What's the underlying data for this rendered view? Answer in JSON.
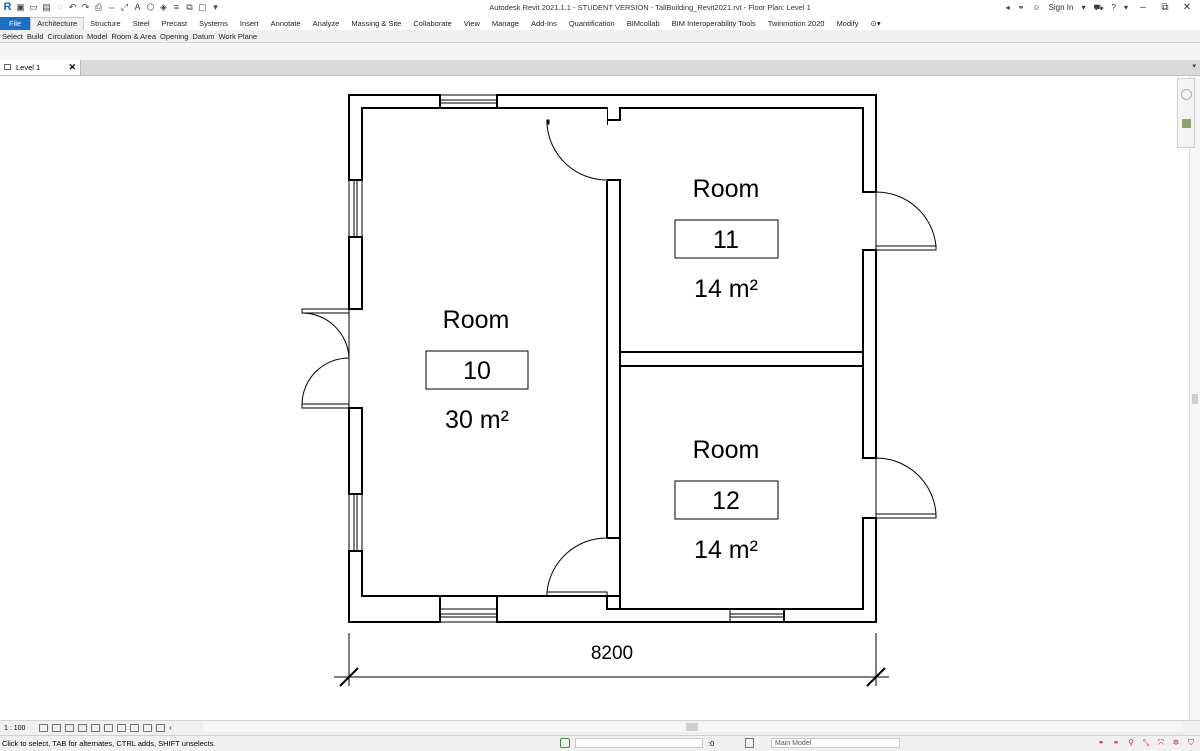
{
  "app": {
    "title": "Autodesk Revit 2021.1.1 - STUDENT VERSION - TallBuilding_Revit2021.rvt - Floor Plan: Level 1",
    "sign_in": "Sign In",
    "help": "?"
  },
  "quick_access": {
    "logo": "R",
    "text_tool": "A"
  },
  "ribbon": {
    "tabs": [
      "File",
      "Architecture",
      "Structure",
      "Steel",
      "Precast",
      "Systems",
      "Insert",
      "Annotate",
      "Analyze",
      "Massing & Site",
      "Collaborate",
      "View",
      "Manage",
      "Add-Ins",
      "Quantification",
      "BIMcollab",
      "BIM Interoperability Tools",
      "Twinmotion 2020",
      "Modify"
    ],
    "active_tab": "Architecture",
    "panels": [
      "Select",
      "Build",
      "Circulation",
      "Model",
      "Room & Area",
      "Opening",
      "Datum",
      "Work Plane"
    ]
  },
  "view_tab": {
    "label": "Level 1",
    "close": "✕"
  },
  "plan": {
    "rooms": [
      {
        "name": "Room",
        "number": "10",
        "area": "30 m²"
      },
      {
        "name": "Room",
        "number": "11",
        "area": "14 m²"
      },
      {
        "name": "Room",
        "number": "12",
        "area": "14 m²"
      }
    ],
    "dimension": "8200"
  },
  "view_control": {
    "scale": "1 : 100"
  },
  "status": {
    "message": "Click to select, TAB for alternates, CTRL adds, SHIFT unselects.",
    "zero": ":0",
    "model": "Main Model"
  }
}
